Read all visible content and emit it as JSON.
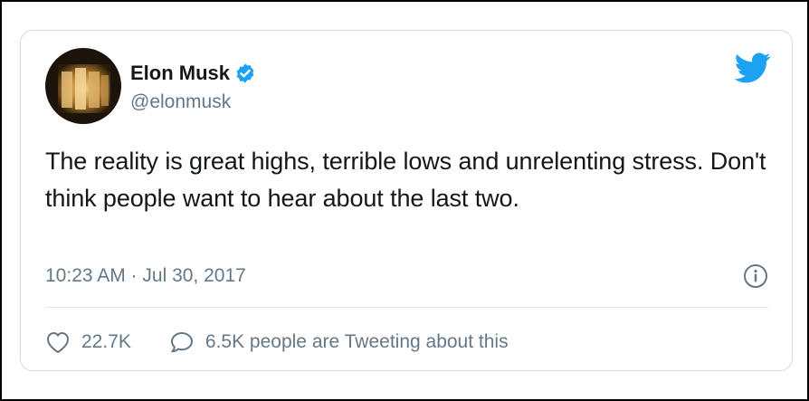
{
  "tweet": {
    "display_name": "Elon Musk",
    "handle": "@elonmusk",
    "verified": true,
    "text": "The reality is great highs, terrible lows and unrelenting stress. Don't think people want to hear about the last two.",
    "timestamp": "10:23 AM · Jul 30, 2017",
    "likes": "22.7K",
    "replies_text": "6.5K people are Tweeting about this"
  },
  "icons": {
    "brand": "twitter-bird-icon",
    "verified": "verified-badge-icon",
    "info": "info-icon",
    "like": "heart-icon",
    "reply": "speech-bubble-icon"
  },
  "colors": {
    "brand_blue": "#1da1f2",
    "text_primary": "#14171a",
    "text_secondary": "#657786",
    "border": "#d3d9dd"
  }
}
